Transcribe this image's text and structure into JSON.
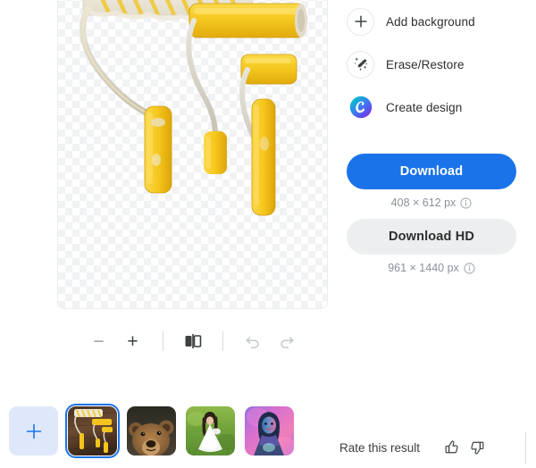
{
  "canvas": {
    "name": "image-preview-canvas",
    "background_type": "transparent-checkerboard",
    "subject": "yellow paint rollers with white fuzzy roller sleeve"
  },
  "toolbar": {
    "zoom_out_label": "−",
    "zoom_out_icon": "minus-icon",
    "zoom_in_label": "+",
    "zoom_in_icon": "plus-icon",
    "compare_icon": "before-after-compare-icon",
    "undo_icon": "undo-arrow-icon",
    "redo_icon": "redo-arrow-icon"
  },
  "actions": [
    {
      "label": "Add background",
      "icon": "plus-icon"
    },
    {
      "label": "Erase/Restore",
      "icon": "magic-brush-icon"
    },
    {
      "label": "Create design",
      "icon": "canva-logo-icon"
    }
  ],
  "download": {
    "primary_label": "Download",
    "primary_size": "408 × 612 px",
    "primary_info_icon": "info-circle-icon",
    "hd_label": "Download HD",
    "hd_size": "961 × 1440 px",
    "hd_info_icon": "info-circle-icon",
    "primary_color": "#1a73e8",
    "secondary_color": "#eceef0"
  },
  "thumbnails": {
    "add_button_icon": "plus-icon",
    "items": [
      {
        "name": "paint-rollers-thumbnail",
        "selected": true,
        "description": "yellow paint rollers on dark wood"
      },
      {
        "name": "bear-thumbnail",
        "selected": false,
        "description": "brown grizzly bear portrait"
      },
      {
        "name": "girl-in-field-thumbnail",
        "selected": false,
        "description": "girl in white dress on green grass"
      },
      {
        "name": "neon-portrait-thumbnail",
        "selected": false,
        "description": "woman portrait with pink and blue neon light"
      }
    ]
  },
  "rate": {
    "label": "Rate this result",
    "thumbs_up_icon": "thumbs-up-icon",
    "thumbs_down_icon": "thumbs-down-icon"
  }
}
